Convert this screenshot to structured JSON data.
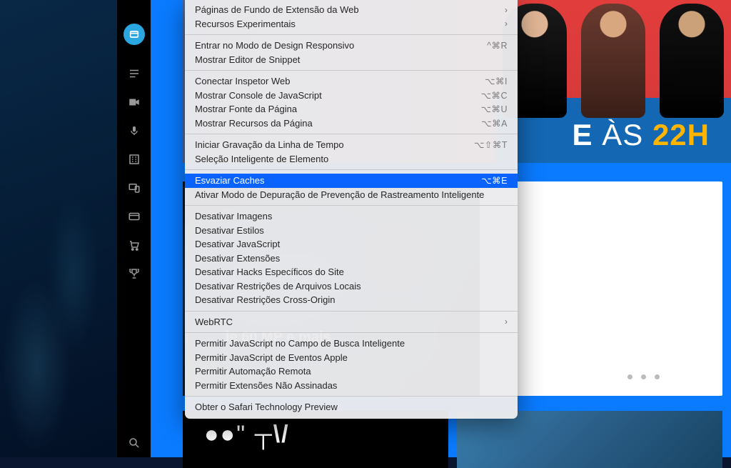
{
  "sidebar": {
    "icons": [
      "lines-icon",
      "camera-icon",
      "mic-icon",
      "building-icon",
      "devices-icon",
      "badge-icon",
      "cart-icon",
      "trophy-icon",
      "search-icon"
    ]
  },
  "hero": {
    "text_prefix": "E",
    "text_thin": "ÀS",
    "text_yellow": "22H"
  },
  "card": {
    "headline_tail": "le 60 MP e mais"
  },
  "strip": {
    "tv_label": "⌃⌃\" T\\/"
  },
  "menu": {
    "groups": [
      [
        {
          "label": "Páginas de Fundo de Extensão da Web",
          "submenu": true
        },
        {
          "label": "Recursos Experimentais",
          "submenu": true
        }
      ],
      [
        {
          "label": "Entrar no Modo de Design Responsivo",
          "shortcut": "^⌘R"
        },
        {
          "label": "Mostrar Editor de Snippet"
        }
      ],
      [
        {
          "label": "Conectar Inspetor Web",
          "shortcut": "⌥⌘I"
        },
        {
          "label": "Mostrar Console de JavaScript",
          "shortcut": "⌥⌘C"
        },
        {
          "label": "Mostrar Fonte da Página",
          "shortcut": "⌥⌘U"
        },
        {
          "label": "Mostrar Recursos da Página",
          "shortcut": "⌥⌘A"
        }
      ],
      [
        {
          "label": "Iniciar Gravação da Linha de Tempo",
          "shortcut": "⌥⇧⌘T"
        },
        {
          "label": "Seleção Inteligente de Elemento"
        }
      ],
      [
        {
          "label": "Esvaziar Caches",
          "shortcut": "⌥⌘E",
          "selected": true
        },
        {
          "label": "Ativar Modo de Depuração de Prevenção de Rastreamento Inteligente"
        }
      ],
      [
        {
          "label": "Desativar Imagens"
        },
        {
          "label": "Desativar Estilos"
        },
        {
          "label": "Desativar JavaScript"
        },
        {
          "label": "Desativar Extensões"
        },
        {
          "label": "Desativar Hacks Específicos do Site"
        },
        {
          "label": "Desativar Restrições de Arquivos Locais"
        },
        {
          "label": "Desativar Restrições Cross-Origin"
        }
      ],
      [
        {
          "label": "WebRTC",
          "submenu": true
        }
      ],
      [
        {
          "label": "Permitir JavaScript no Campo de Busca Inteligente"
        },
        {
          "label": "Permitir JavaScript de Eventos Apple"
        },
        {
          "label": "Permitir Automação Remota"
        },
        {
          "label": "Permitir Extensões Não Assinadas"
        }
      ],
      [
        {
          "label": "Obter o Safari Technology Preview"
        }
      ]
    ]
  }
}
